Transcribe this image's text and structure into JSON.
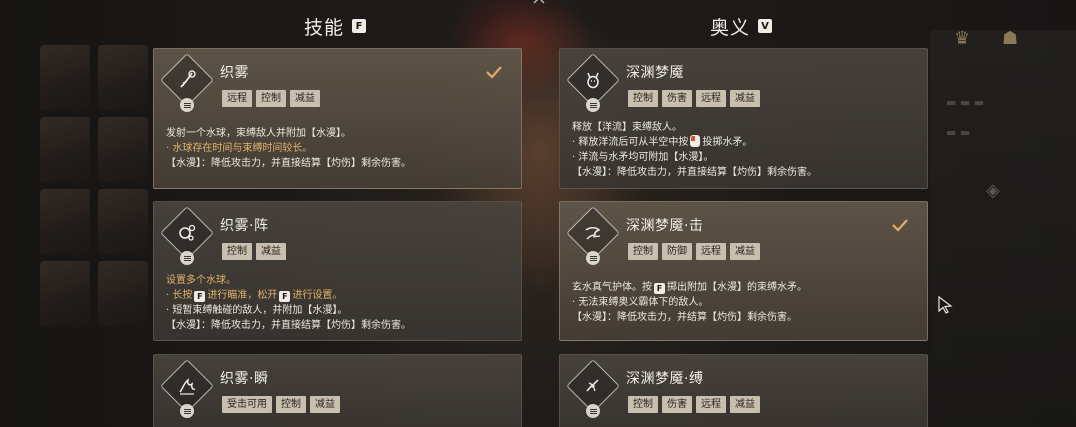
{
  "headers": {
    "skills": {
      "title": "技能",
      "key": "F"
    },
    "ultimate": {
      "title": "奥义",
      "key": "V"
    }
  },
  "icons": {
    "badge": "diamond-skill-badge-icon",
    "menu": "menu-lines-icon",
    "selected": "checkmark-icon",
    "cursor": "mouse-cursor-icon"
  },
  "colors": {
    "accent": "#e0b26a",
    "check": "#e8a868",
    "tag_bg": "#c9bfae"
  },
  "skills": [
    {
      "name": "织雾",
      "tags": [
        "远程",
        "控制",
        "减益"
      ],
      "selected": true,
      "lines": [
        "发射一个水球，束缚敌人并附加【水漫】。",
        "· 水球存在时间与束缚时间较长。",
        "【水漫】：降低攻击力，并直接结算【灼伤】剩余伤害。"
      ]
    },
    {
      "name": "织雾·阵",
      "tags": [
        "控制",
        "减益"
      ],
      "selected": false,
      "lines": [
        "设置多个水球。",
        "· 长按",
        "进行瞄准，松开",
        "进行设置。",
        "· 短暂束缚触碰的敌人，并附加【水漫】。",
        "【水漫】：降低攻击力，并直接结算【灼伤】剩余伤害。"
      ]
    },
    {
      "name": "织雾·瞬",
      "tags": [
        "受击可用",
        "控制",
        "减益"
      ],
      "selected": false
    }
  ],
  "ultimates": [
    {
      "name": "深渊梦魇",
      "tags": [
        "控制",
        "伤害",
        "远程",
        "减益"
      ],
      "selected": false,
      "lines": [
        "释放【洋流】束缚敌人。",
        "· 释放洋流后可从半空中按",
        "投掷水矛。",
        "· 洋流与水矛均可附加【水漫】。",
        "【水漫】：降低攻击力，并直接结算【灼伤】剩余伤害。"
      ]
    },
    {
      "name": "深渊梦魇·击",
      "tags": [
        "控制",
        "防御",
        "远程",
        "减益"
      ],
      "selected": true,
      "lines": [
        "玄水真气护体。按",
        "掷出附加【水漫】的束缚水矛。",
        "· 无法束缚奥义霸体下的敌人。",
        "【水漫】：降低攻击力，并结算【灼伤】剩余伤害。"
      ]
    },
    {
      "name": "深渊梦魇·缚",
      "tags": [
        "控制",
        "伤害",
        "远程",
        "减益"
      ],
      "selected": false
    }
  ]
}
